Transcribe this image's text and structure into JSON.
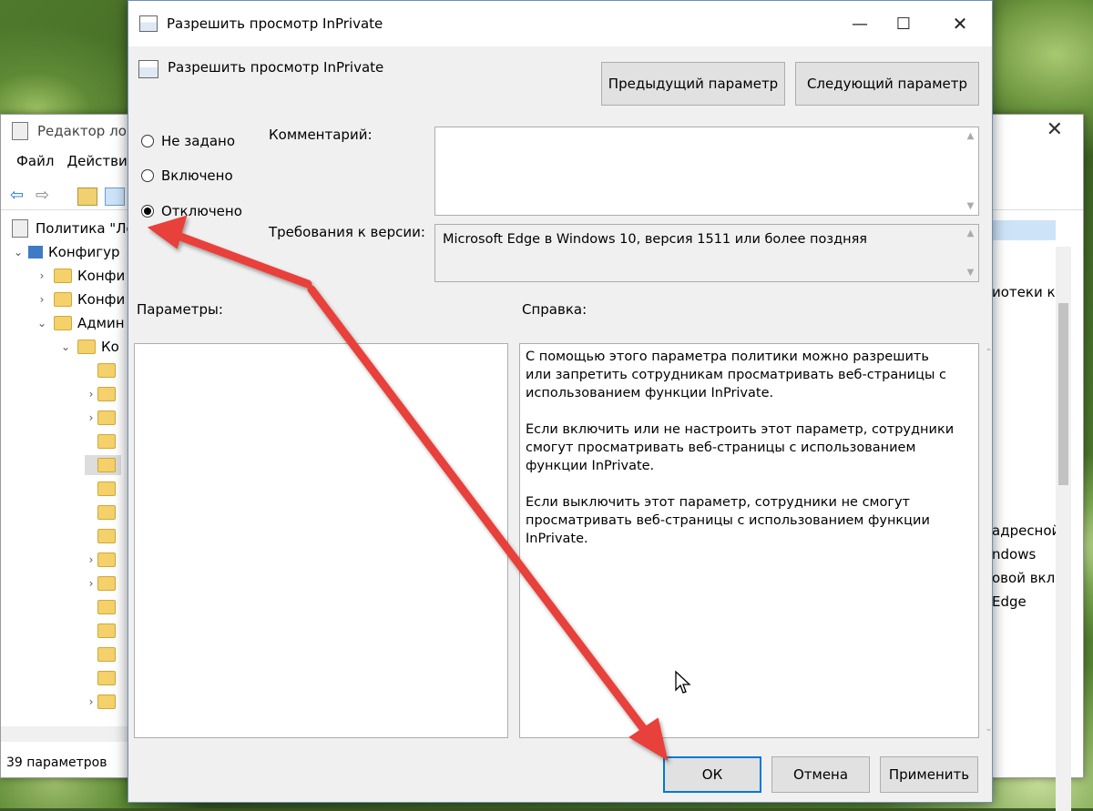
{
  "editor": {
    "title": "Редактор ло",
    "menu": [
      "Файл",
      "Действи"
    ],
    "tree": [
      {
        "label": "Политика \"Ло",
        "indent": 0
      },
      {
        "label": "Конфигур",
        "indent": 1
      },
      {
        "label": "Конфи",
        "indent": 2
      },
      {
        "label": "Конфи",
        "indent": 2
      },
      {
        "label": "Админ",
        "indent": 2
      },
      {
        "label": "Ко",
        "indent": 3
      }
    ],
    "right_fragments": [
      "иотеки к",
      "адресной",
      "ndows",
      "овой вкл.",
      "Edge"
    ],
    "status": "39 параметров"
  },
  "dialog": {
    "title": "Разрешить просмотр InPrivate",
    "header_title": "Разрешить просмотр InPrivate",
    "prev_button": "Предыдущий параметр",
    "next_button": "Следующий параметр",
    "options": [
      {
        "label": "Не задано",
        "selected": false
      },
      {
        "label": "Включено",
        "selected": false
      },
      {
        "label": "Отключено",
        "selected": true
      }
    ],
    "comment_label": "Комментарий:",
    "version_label": "Требования к версии:",
    "version_value": "Microsoft Edge в Windows 10, версия 1511 или более поздняя",
    "params_label": "Параметры:",
    "help_label": "Справка:",
    "help_paragraphs": [
      "С помощью этого параметра политики можно разрешить или запретить сотрудникам просматривать веб-страницы с использованием функции InPrivate.",
      "Если включить или не настроить этот параметр, сотрудники смогут просматривать веб-страницы с использованием функции InPrivate.",
      "Если выключить этот параметр, сотрудники не смогут просматривать веб-страницы с использованием функции InPrivate."
    ],
    "ok_button": "ОК",
    "cancel_button": "Отмена",
    "apply_button": "Применить"
  },
  "colors": {
    "accent": "#0078d7",
    "arrow": "#e8403a"
  }
}
